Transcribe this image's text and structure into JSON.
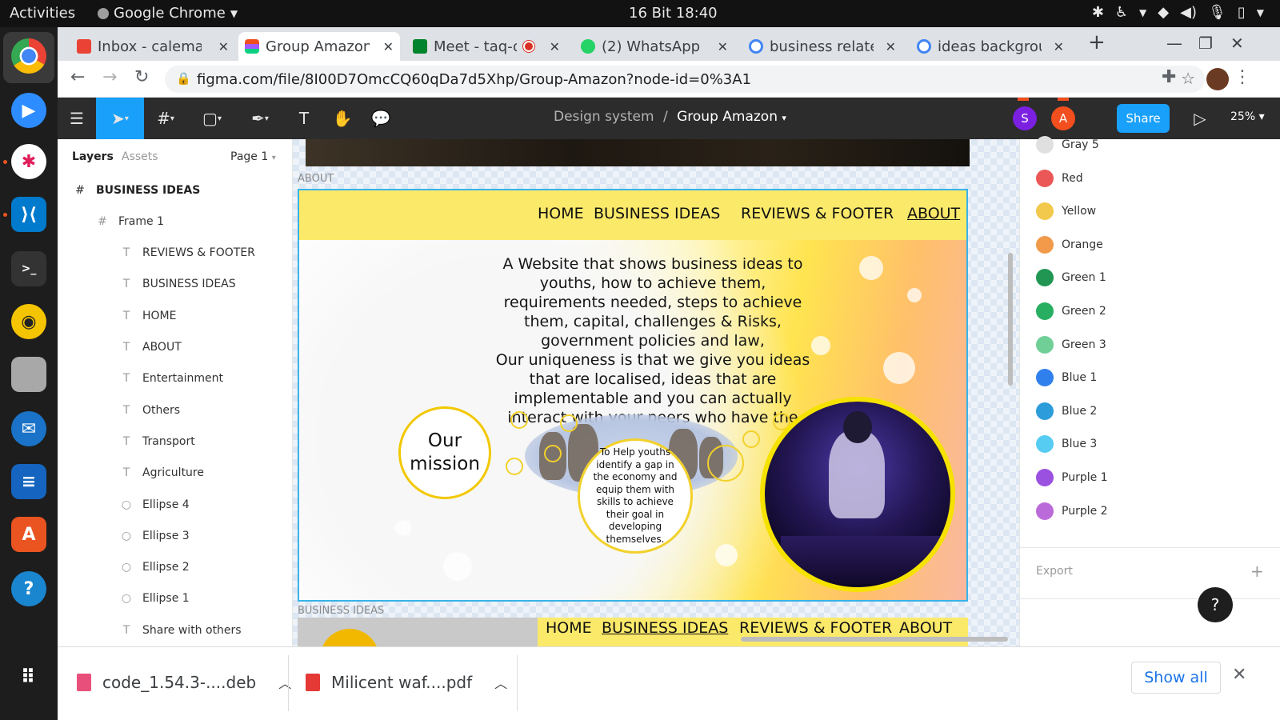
{
  "system": {
    "activities": "Activities",
    "app_menu": "Google Chrome",
    "clock": "16 Bit  18:40"
  },
  "tabs": [
    {
      "title": "Inbox - calemas",
      "fav_color": "#ea4335"
    },
    {
      "title": "Group Amazon -",
      "fav_color": "#a259ff"
    },
    {
      "title": "Meet - taq-o",
      "fav_color": "#00832d"
    },
    {
      "title": "(2) WhatsApp",
      "fav_color": "#25d366"
    },
    {
      "title": "business relate",
      "fav_color": "#4285f4"
    },
    {
      "title": "ideas backgrou",
      "fav_color": "#4285f4"
    }
  ],
  "new_tab": "+",
  "browser": {
    "url": "figma.com/file/8I00D7OmcCQ60qDa7d5Xhp/Group-Amazon?node-id=0%3A1"
  },
  "figma": {
    "breadcrumb_project": "Design system",
    "breadcrumb_sep": "/",
    "file_name": "Group Amazon",
    "avatar_s": "S",
    "avatar_a": "A",
    "share_label": "Share",
    "zoom": "25%"
  },
  "layers_panel": {
    "tab_layers": "Layers",
    "tab_assets": "Assets",
    "page": "Page 1",
    "items": [
      {
        "label": "BUSINESS IDEAS",
        "icon": "#"
      },
      {
        "label": "Frame 1",
        "icon": "#"
      },
      {
        "label": "REVIEWS & FOOTER",
        "icon": "T"
      },
      {
        "label": "BUSINESS IDEAS",
        "icon": "T"
      },
      {
        "label": "HOME",
        "icon": "T"
      },
      {
        "label": "ABOUT",
        "icon": "T"
      },
      {
        "label": "Entertainment",
        "icon": "T"
      },
      {
        "label": "Others",
        "icon": "T"
      },
      {
        "label": "Transport",
        "icon": "T"
      },
      {
        "label": "Agriculture",
        "icon": "T"
      },
      {
        "label": "Ellipse 4",
        "icon": "○"
      },
      {
        "label": "Ellipse 3",
        "icon": "○"
      },
      {
        "label": "Ellipse 2",
        "icon": "○"
      },
      {
        "label": "Ellipse 1",
        "icon": "○"
      },
      {
        "label": "Share with others",
        "icon": "T"
      }
    ]
  },
  "canvas": {
    "frame_label_about": "ABOUT",
    "frame_label_business": "BUSINESS IDEAS",
    "nav": {
      "home": "HOME",
      "business_ideas": "BUSINESS IDEAS",
      "reviews_footer": "REVIEWS & FOOTER",
      "about": "ABOUT"
    },
    "hero_text": "A Website that shows business ideas to youths, how to achieve them, requirements needed, steps to achieve them, capital, challenges & Risks, government policies and law,\nOur uniqueness is that we give you ideas that are localised, ideas that are implementable and you can actually interact with your peers who have the skills.",
    "mission": "Our mission",
    "goal_text": "To Help youths identify a gap in the economy and equip them with skills to achieve their goal in developing themselves."
  },
  "color_styles": [
    {
      "name": "Gray 5",
      "color": "#e0e0e0"
    },
    {
      "name": "Red",
      "color": "#eb5757"
    },
    {
      "name": "Yellow",
      "color": "#f2c94c"
    },
    {
      "name": "Orange",
      "color": "#f2994a"
    },
    {
      "name": "Green 1",
      "color": "#219653"
    },
    {
      "name": "Green 2",
      "color": "#27ae60"
    },
    {
      "name": "Green 3",
      "color": "#6fcf97"
    },
    {
      "name": "Blue 1",
      "color": "#2f80ed"
    },
    {
      "name": "Blue 2",
      "color": "#2d9cdb"
    },
    {
      "name": "Blue 3",
      "color": "#56ccf2"
    },
    {
      "name": "Purple 1",
      "color": "#9b51e0"
    },
    {
      "name": "Purple 2",
      "color": "#bb6bd9"
    }
  ],
  "export_label": "Export",
  "help": "?",
  "downloads": {
    "item1": "code_1.54.3-....deb",
    "item2": "Milicent waf....pdf",
    "show_all": "Show all"
  }
}
